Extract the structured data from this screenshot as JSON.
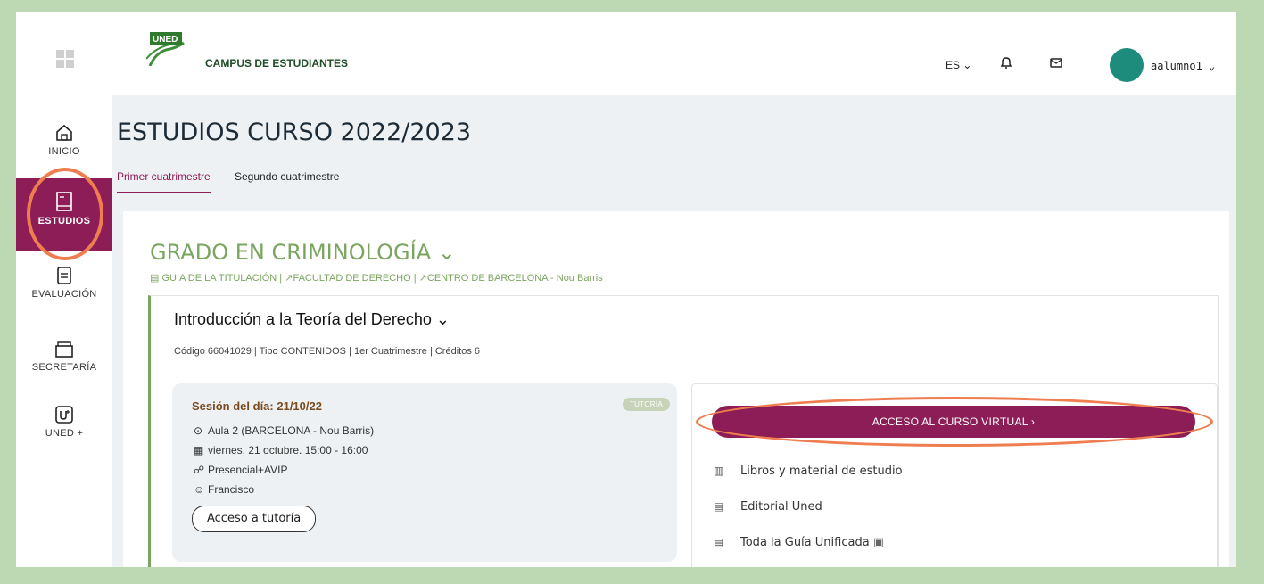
{
  "header": {
    "brand_logo": "UNED",
    "brand": "CAMPUS DE ESTUDIANTES",
    "lang": "ES ⌄",
    "user": "aalumno1 ⌄"
  },
  "sidebar": {
    "items": [
      {
        "label": "INICIO",
        "icon": "home-icon"
      },
      {
        "label": "ESTUDIOS",
        "icon": "book-icon"
      },
      {
        "label": "EVALUACIÓN",
        "icon": "clipboard-icon"
      },
      {
        "label": "SECRETARÍA",
        "icon": "archive-icon"
      },
      {
        "label": "UNED +",
        "icon": "uned-plus-icon"
      }
    ]
  },
  "page": {
    "title": "ESTUDIOS CURSO 2022/2023",
    "tabs": [
      "Primer cuatrimestre",
      "Segundo cuatrimestre"
    ]
  },
  "degree": {
    "title": "GRADO EN CRIMINOLOGÍA ⌄",
    "links": [
      "GUIA DE LA TITULACIÓN",
      "FACULTAD DE DERECHO",
      "CENTRO DE BARCELONA - Nou Barris"
    ]
  },
  "subject": {
    "title": "Introducción a la Teoría del Derecho ⌄",
    "meta": "Código 66041029 | Tipo CONTENIDOS | 1er Cuatrimestre | Créditos 6"
  },
  "session": {
    "title": "Sesión del día: 21/10/22",
    "badge": "TUTORÍA",
    "location": "Aula 2 (BARCELONA - Nou Barris)",
    "datetime": "viernes, 21 octubre. 15:00 - 16:00",
    "mode": "Presencial+AVIP",
    "tutor": "Francisco",
    "button": "Acceso a tutoría"
  },
  "panel": {
    "cta": "ACCESO AL CURSO VIRTUAL ›",
    "links": [
      "Libros y material de estudio",
      "Editorial Uned",
      "Toda la Guía Unificada"
    ]
  },
  "colors": {
    "accent": "#8c1d56",
    "green": "#7aa55e",
    "highlight": "#ee7e50"
  }
}
